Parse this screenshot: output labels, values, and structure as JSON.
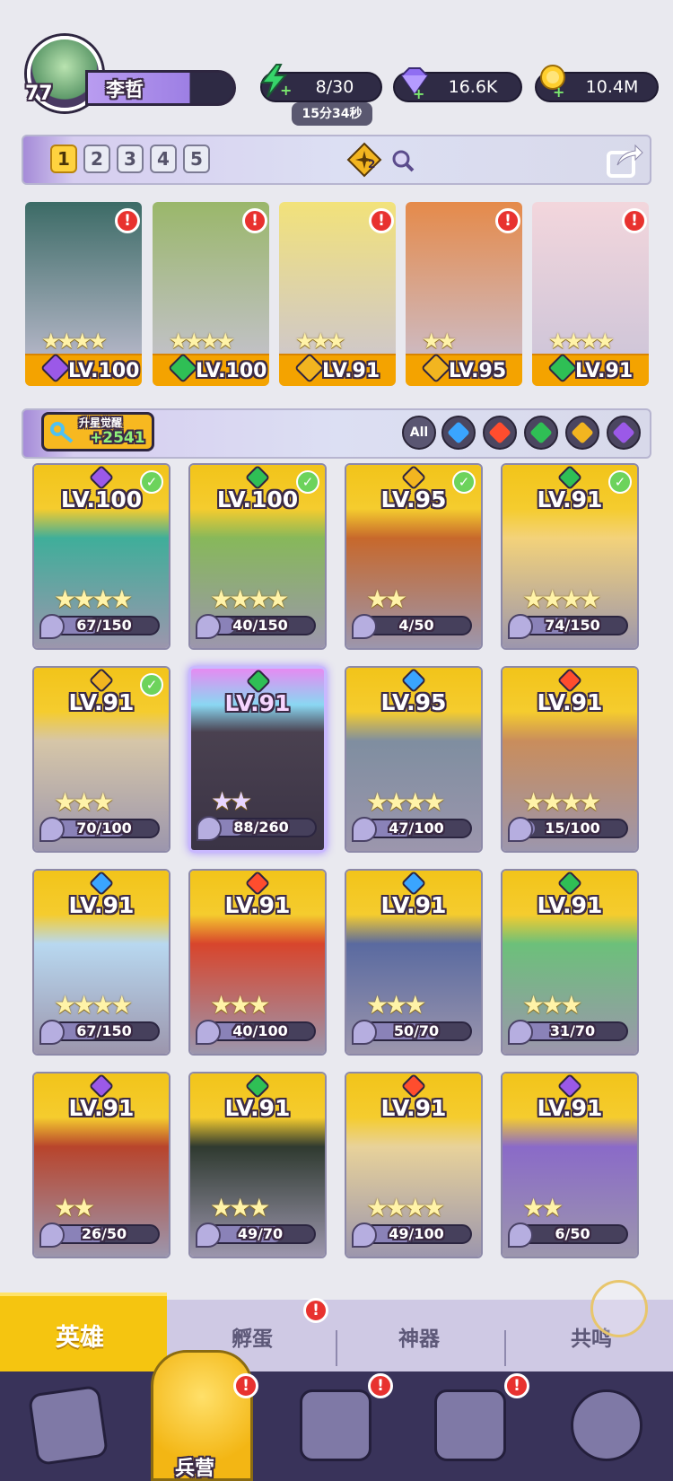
{
  "player": {
    "level": "77",
    "name": "李哲"
  },
  "resources": {
    "energy": "8/30",
    "energy_timer": "15分34秒",
    "gems": "16.6K",
    "gold": "10.4M"
  },
  "team_tabs": [
    "1",
    "2",
    "3",
    "4",
    "5"
  ],
  "team_badge": "2",
  "team": [
    {
      "level": "LV.100",
      "stars": 4,
      "element": "dark",
      "element_color": "#9b59e8"
    },
    {
      "level": "LV.100",
      "stars": 4,
      "element": "nature",
      "element_color": "#2fbf55"
    },
    {
      "level": "LV.91",
      "stars": 3,
      "element": "light",
      "element_color": "#f2b520"
    },
    {
      "level": "LV.95",
      "stars": 2,
      "element": "light",
      "element_color": "#f2b520"
    },
    {
      "level": "LV.91",
      "stars": 4,
      "element": "nature",
      "element_color": "#2fbf55"
    }
  ],
  "awaken": {
    "title": "升星觉醒",
    "value": "+2541"
  },
  "filters": [
    {
      "label": "All",
      "color": "#4b4660"
    },
    {
      "label": "",
      "color": "#3aa5ff"
    },
    {
      "label": "",
      "color": "#ff4d2e"
    },
    {
      "label": "",
      "color": "#2fbf55"
    },
    {
      "label": "",
      "color": "#f2b520"
    },
    {
      "label": "",
      "color": "#9b59e8"
    }
  ],
  "heroes": [
    {
      "level": "LV.100",
      "progress": "67/150",
      "fill": 0.45,
      "stars": 4,
      "element_color": "#9b59e8",
      "checked": true,
      "bg": "#3fae9a"
    },
    {
      "level": "LV.100",
      "progress": "40/150",
      "fill": 0.27,
      "stars": 4,
      "element_color": "#2fbf55",
      "checked": true,
      "bg": "#87b85a"
    },
    {
      "level": "LV.95",
      "progress": "4/50",
      "fill": 0.08,
      "stars": 2,
      "element_color": "#f2b520",
      "checked": true,
      "bg": "#c7682c"
    },
    {
      "level": "LV.91",
      "progress": "74/150",
      "fill": 0.49,
      "stars": 4,
      "element_color": "#2fbf55",
      "checked": true,
      "bg": "#f3d27a"
    },
    {
      "level": "LV.91",
      "progress": "70/100",
      "fill": 0.7,
      "stars": 3,
      "element_color": "#f2b520",
      "checked": true,
      "bg": "#d6c6a8"
    },
    {
      "level": "LV.91",
      "progress": "88/260",
      "fill": 0.34,
      "stars": 2,
      "element_color": "#2fbf55",
      "checked": false,
      "bg": "#4a4150"
    },
    {
      "level": "LV.95",
      "progress": "47/100",
      "fill": 0.47,
      "stars": 4,
      "element_color": "#3aa5ff",
      "checked": false,
      "bg": "#7f8ea0"
    },
    {
      "level": "LV.91",
      "progress": "15/100",
      "fill": 0.15,
      "stars": 4,
      "element_color": "#ff4d2e",
      "checked": false,
      "bg": "#c98d5c"
    },
    {
      "level": "LV.91",
      "progress": "67/150",
      "fill": 0.45,
      "stars": 4,
      "element_color": "#3aa5ff",
      "checked": false,
      "bg": "#b8d8f0"
    },
    {
      "level": "LV.91",
      "progress": "40/100",
      "fill": 0.4,
      "stars": 3,
      "element_color": "#ff4d2e",
      "checked": false,
      "bg": "#d8452c"
    },
    {
      "level": "LV.91",
      "progress": "50/70",
      "fill": 0.71,
      "stars": 3,
      "element_color": "#3aa5ff",
      "checked": false,
      "bg": "#5a6aa0"
    },
    {
      "level": "LV.91",
      "progress": "31/70",
      "fill": 0.44,
      "stars": 3,
      "element_color": "#2fbf55",
      "checked": false,
      "bg": "#6cc07a"
    },
    {
      "level": "LV.91",
      "progress": "26/50",
      "fill": 0.52,
      "stars": 2,
      "element_color": "#9b59e8",
      "checked": false,
      "bg": "#b8442c"
    },
    {
      "level": "LV.91",
      "progress": "49/70",
      "fill": 0.7,
      "stars": 3,
      "element_color": "#2fbf55",
      "checked": false,
      "bg": "#2f3a30"
    },
    {
      "level": "LV.91",
      "progress": "49/100",
      "fill": 0.49,
      "stars": 4,
      "element_color": "#ff4d2e",
      "checked": false,
      "bg": "#e8d29a"
    },
    {
      "level": "LV.91",
      "progress": "6/50",
      "fill": 0.12,
      "stars": 2,
      "element_color": "#9b59e8",
      "checked": false,
      "bg": "#8a6ac8"
    }
  ],
  "sub_tabs": [
    "英雄",
    "孵蛋",
    "神器",
    "共鸣"
  ],
  "nav": {
    "barracks": "兵营"
  }
}
